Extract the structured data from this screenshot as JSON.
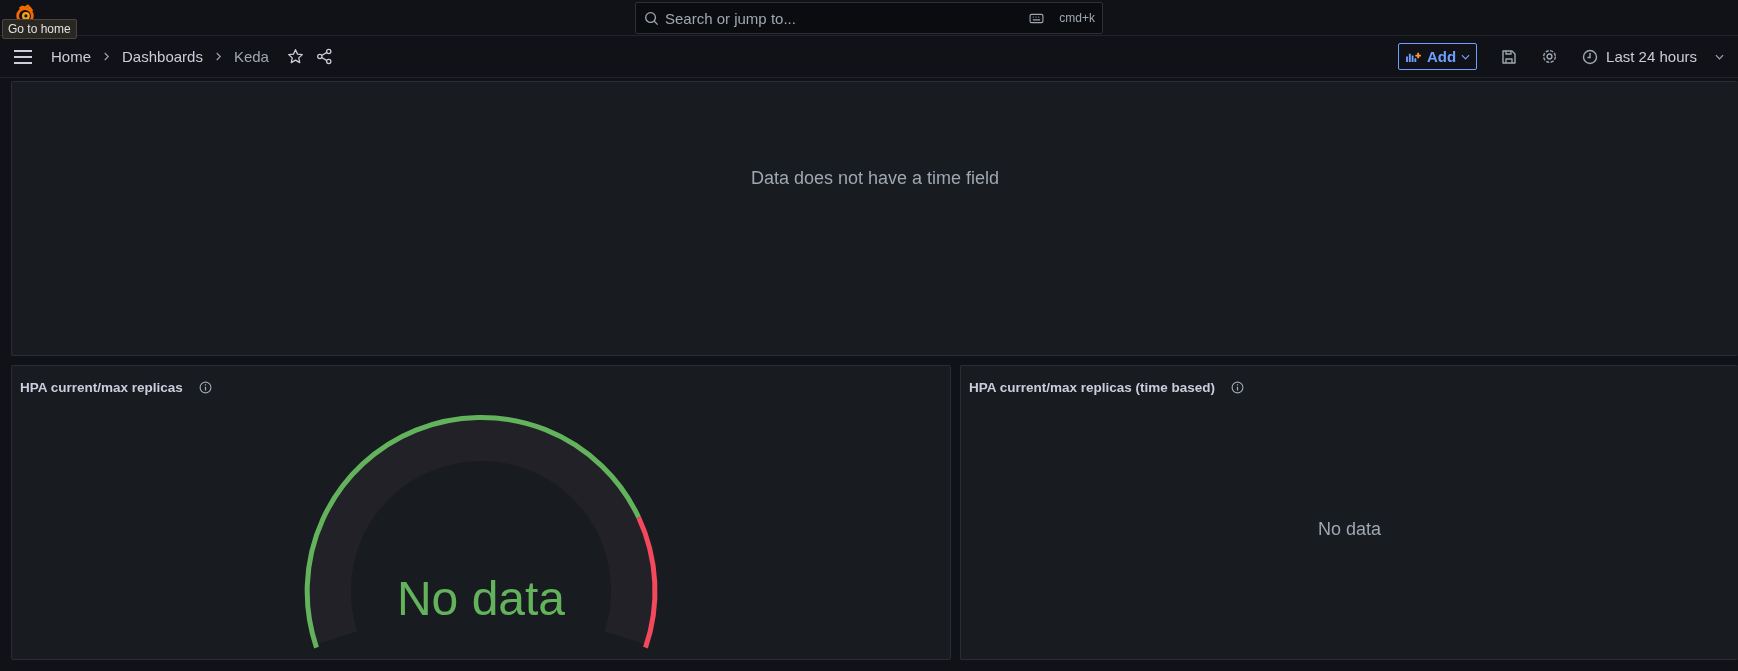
{
  "topbar": {
    "tooltip": "Go to home",
    "search": {
      "placeholder": "Search or jump to...",
      "shortcut": "cmd+k"
    }
  },
  "breadcrumbs": [
    {
      "label": "Home",
      "current": false
    },
    {
      "label": "Dashboards",
      "current": false
    },
    {
      "label": "Keda",
      "current": true
    }
  ],
  "toolbar": {
    "add_button": "Add",
    "time_range": "Last 24 hours"
  },
  "panels": [
    {
      "kind": "message",
      "message": "Data does not have a time field"
    },
    {
      "kind": "gauge",
      "title": "HPA current/max replicas",
      "value": "No data"
    },
    {
      "kind": "message",
      "title": "HPA current/max replicas (time based)",
      "message": "No data"
    }
  ]
}
